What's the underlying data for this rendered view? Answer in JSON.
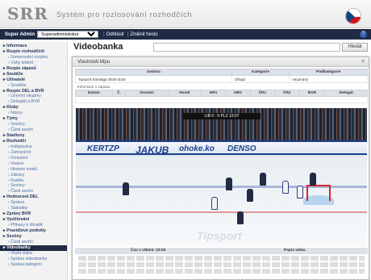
{
  "header": {
    "logo": "SRR",
    "subtitle": "Systém pro rozlosování rozhodčích"
  },
  "topbar": {
    "role_label": "Super Admin",
    "role_value": "Superadministrátor",
    "logout": "Odhlásit",
    "change_password": "Změnit heslo",
    "help": "?"
  },
  "sidebar": {
    "items": [
      {
        "label": "Informace",
        "type": "cat"
      },
      {
        "label": "Rozpis rozhodčích",
        "type": "cat"
      },
      {
        "label": "Generování rozpisu",
        "type": "sub"
      },
      {
        "label": "Váhy kritérií",
        "type": "sub"
      },
      {
        "label": "Rozpis zápasů",
        "type": "cat"
      },
      {
        "label": "Soutěže",
        "type": "cat"
      },
      {
        "label": "Uživatelé",
        "type": "cat"
      },
      {
        "label": "Soutěže",
        "type": "sub"
      },
      {
        "label": "Rozpis DEL a BVR",
        "type": "cat"
      },
      {
        "label": "Územní skupiny",
        "type": "sub"
      },
      {
        "label": "Delegáti a BVR",
        "type": "sub"
      },
      {
        "label": "Kluby",
        "type": "cat"
      },
      {
        "label": "Názvy",
        "type": "sub"
      },
      {
        "label": "Týmy",
        "type": "cat"
      },
      {
        "label": "Sezóny",
        "type": "sub"
      },
      {
        "label": "Části sezón",
        "type": "sub"
      },
      {
        "label": "Stadiony",
        "type": "cat"
      },
      {
        "label": "Rozhodčí",
        "type": "cat"
      },
      {
        "label": "Indispozice",
        "type": "sub"
      },
      {
        "label": "Zahraniční",
        "type": "sub"
      },
      {
        "label": "Omezení",
        "type": "sub"
      },
      {
        "label": "Vetace",
        "type": "sub"
      },
      {
        "label": "Historie trestů",
        "type": "sub"
      },
      {
        "label": "Zákazy",
        "type": "sub"
      },
      {
        "label": "Kvalita",
        "type": "sub"
      },
      {
        "label": "Sezóny",
        "type": "sub"
      },
      {
        "label": "Části sezón",
        "type": "sub"
      },
      {
        "label": "Hodnocení DEL",
        "type": "cat"
      },
      {
        "label": "Správa",
        "type": "sub"
      },
      {
        "label": "Statistiky",
        "type": "sub"
      },
      {
        "label": "Zprávy BVR",
        "type": "cat"
      },
      {
        "label": "Vyúčtování",
        "type": "cat"
      },
      {
        "label": "Příkazy k úhradě",
        "type": "sub"
      },
      {
        "label": "Pravidlové podněty",
        "type": "cat"
      },
      {
        "label": "Sezóny",
        "type": "cat"
      },
      {
        "label": "Části sezón",
        "type": "sub"
      },
      {
        "label": "Videobanky",
        "type": "act"
      },
      {
        "label": "Vložit video",
        "type": "sub"
      },
      {
        "label": "Správa videobanky",
        "type": "sub"
      },
      {
        "label": "Správa kategorií",
        "type": "sub"
      }
    ]
  },
  "main": {
    "title": "Videobanka",
    "search_button": "Hledat"
  },
  "dialog": {
    "title": "Vlastnosti klipu",
    "close": "×",
    "meta_headers": [
      "Sezóna",
      "Kategorie",
      "Podkategorie"
    ],
    "meta_row": [
      "Tipsport Extraliga 2015-2016",
      "Ofsajd",
      "neuznaný"
    ],
    "info_label": "Informace o zápasu",
    "match_headers": [
      "Datum",
      "Č.",
      "Domácí",
      "Hosté",
      "HR1",
      "HR2",
      "ČR1",
      "ČR2",
      "BVR",
      "Delegát"
    ],
    "video": {
      "scoreboard": "LIB 0 : 0 PLZ 10:07",
      "ads": [
        "KERTZP",
        "JAKUB",
        "ohoke.ko",
        "DENSO"
      ]
    },
    "footer_headers": [
      "Čas v utkání: 23:53",
      "Popis videa"
    ]
  }
}
